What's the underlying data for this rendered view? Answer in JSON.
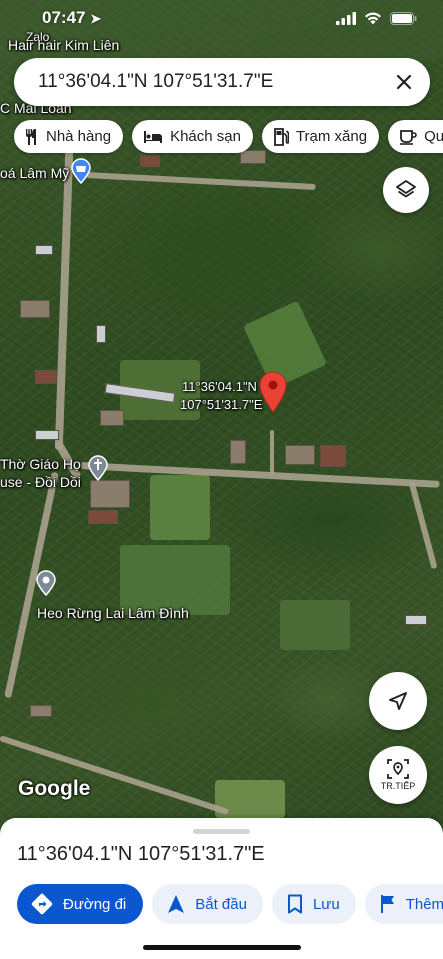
{
  "status_bar": {
    "time": "07:47"
  },
  "search": {
    "query": "11°36'04.1\"N 107°51'31.7\"E"
  },
  "chips": [
    {
      "label": "Nhà hàng",
      "icon": "restaurant-icon"
    },
    {
      "label": "Khách sạn",
      "icon": "hotel-icon"
    },
    {
      "label": "Trạm xăng",
      "icon": "gas-station-icon"
    },
    {
      "label": "Quá",
      "icon": "cafe-icon"
    }
  ],
  "map": {
    "labels": {
      "top_partial": "Zalo",
      "hair_salon": "Hair hair Kim Liên",
      "mai_loan": "C Mai Loan",
      "lam_my": "oá Lâm Mỹ",
      "church_line1": "Thờ Giáo Họ",
      "church_line2": "use - Đồi Dồi",
      "heo_rung": "Heo Rừng Lai Lâm Đình"
    },
    "pin": {
      "line1": "11°36'04.1\"N",
      "line2": "107°51'31.7\"E"
    },
    "watermark": "Google",
    "streetview_label": "TR.TIẾP"
  },
  "sheet": {
    "title": "11°36'04.1\"N 107°51'31.7\"E",
    "actions": [
      {
        "label": "Đường đi",
        "icon": "directions-icon"
      },
      {
        "label": "Bắt đầu",
        "icon": "navigation-arrow-icon"
      },
      {
        "label": "Lưu",
        "icon": "bookmark-icon"
      },
      {
        "label": "Thêm",
        "icon": "flag-icon"
      }
    ]
  },
  "colors": {
    "accent": "#0b57d0",
    "pin": "#ea4335"
  }
}
